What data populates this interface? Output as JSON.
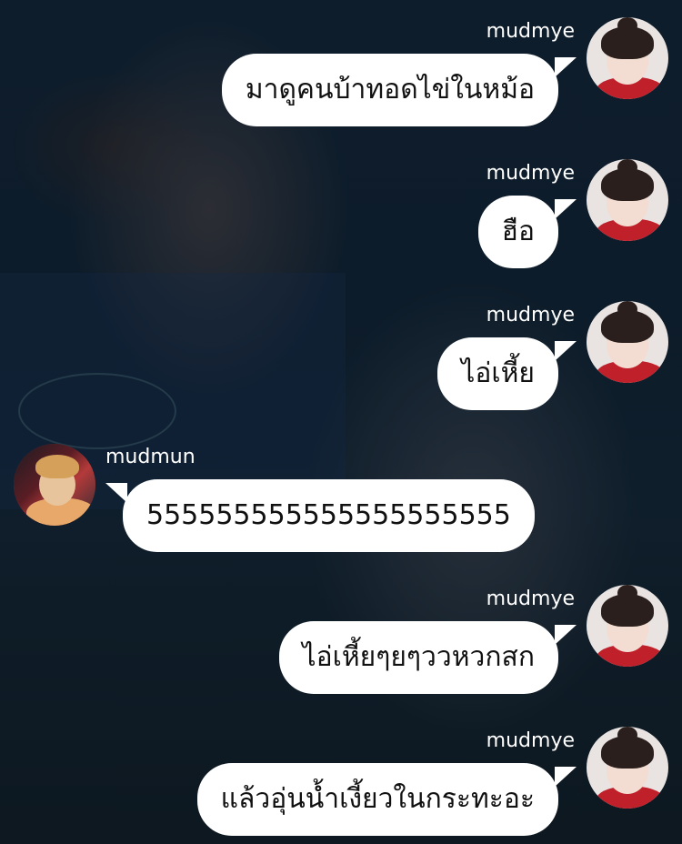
{
  "chat": {
    "messages": [
      {
        "sender": "mudmye",
        "text": "มาดูคนบ้าทอดไข่ในหม้อ",
        "side": "right"
      },
      {
        "sender": "mudmye",
        "text": "ฮือ",
        "side": "right"
      },
      {
        "sender": "mudmye",
        "text": "ไอ่เหี้ย",
        "side": "right"
      },
      {
        "sender": "mudmun",
        "text": "555555555555555555555",
        "side": "left"
      },
      {
        "sender": "mudmye",
        "text": "ไอ่เหี้ยๆยๆววหวกสก",
        "side": "right"
      },
      {
        "sender": "mudmye",
        "text": "แล้วอุ่นน้ำเงี้ยวในกระทะอะ",
        "side": "right"
      }
    ]
  },
  "colors": {
    "bubble": "#ffffff",
    "text": "#111111",
    "name": "#ffffff",
    "background": "#0e1d2c"
  },
  "icons": {
    "mudmye_avatar": "avatar-girl-red-dress",
    "mudmun_avatar": "avatar-boy-orange-jacket"
  }
}
